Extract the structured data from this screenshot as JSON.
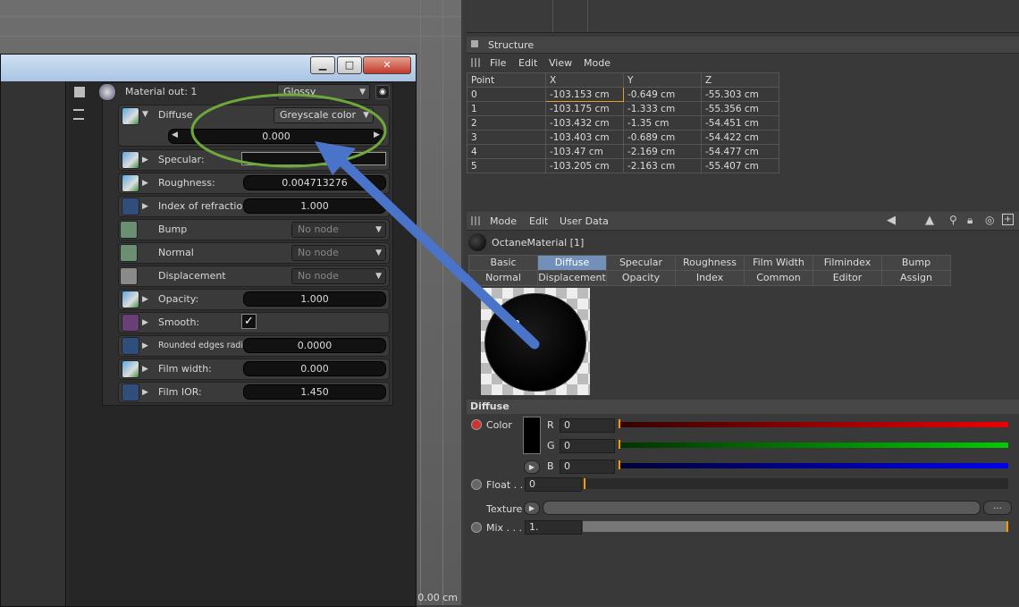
{
  "viewport": {
    "readout": "0.00 cm"
  },
  "window": {
    "minimize_icon": "minimize-icon",
    "maximize_icon": "maximize-icon",
    "close_icon": "close-icon"
  },
  "material_out": {
    "label": "Material out: 1",
    "value": "Glossy"
  },
  "rows": {
    "diffuse": {
      "label": "Diffuse",
      "mode": "Greyscale color",
      "value": "0.000"
    },
    "specular": {
      "label": "Specular:"
    },
    "roughness": {
      "label": "Roughness:",
      "value": "0.004713276"
    },
    "ior": {
      "label": "Index of refraction:",
      "value": "1.000"
    },
    "bump": {
      "label": "Bump",
      "node": "No node"
    },
    "normal": {
      "label": "Normal",
      "node": "No node"
    },
    "displacement": {
      "label": "Displacement",
      "node": "No node"
    },
    "opacity": {
      "label": "Opacity:",
      "value": "1.000"
    },
    "smooth": {
      "label": "Smooth:",
      "check": "✓"
    },
    "rounded": {
      "label": "Rounded edges radius:",
      "value": "0.0000"
    },
    "filmwidth": {
      "label": "Film width:",
      "value": "0.000"
    },
    "filmior": {
      "label": "Film IOR:",
      "value": "1.450"
    }
  },
  "structure": {
    "title": "Structure",
    "menu": [
      "File",
      "Edit",
      "View",
      "Mode"
    ],
    "columns": [
      "Point",
      "X",
      "Y",
      "Z"
    ],
    "rows": [
      [
        "0",
        "-103.153 cm",
        "-0.649 cm",
        "-55.303 cm"
      ],
      [
        "1",
        "-103.175 cm",
        "-1.333 cm",
        "-55.356 cm"
      ],
      [
        "2",
        "-103.432 cm",
        "-1.35 cm",
        "-54.451 cm"
      ],
      [
        "3",
        "-103.403 cm",
        "-0.689 cm",
        "-54.422 cm"
      ],
      [
        "4",
        "-103.47 cm",
        "-2.169 cm",
        "-54.477 cm"
      ],
      [
        "5",
        "-103.205 cm",
        "-2.163 cm",
        "-55.407 cm"
      ]
    ]
  },
  "attributes": {
    "menu": [
      "Mode",
      "Edit",
      "User Data"
    ],
    "material_name": "OctaneMaterial [1]",
    "tabs_row1": [
      "Basic",
      "Diffuse",
      "Specular",
      "Roughness",
      "Film Width",
      "Filmindex",
      "Bump"
    ],
    "tabs_row2": [
      "Normal",
      "Displacement",
      "Opacity",
      "Index",
      "Common",
      "Editor",
      "Assign"
    ],
    "active_tab": "Diffuse",
    "section": "Diffuse",
    "color_label": "Color",
    "r_label": "R",
    "g_label": "G",
    "b_label": "B",
    "r": "0",
    "g": "0",
    "b": "0",
    "float_label": "Float . .",
    "float_value": "0",
    "texture_label": "Texture",
    "texture_button": "...",
    "mix_label": "Mix . . .",
    "mix_value": "1."
  },
  "colors": {
    "accent": "#7390b8",
    "annotation_arrow": "#4a74c9",
    "annotation_circle": "#6fa83a"
  }
}
